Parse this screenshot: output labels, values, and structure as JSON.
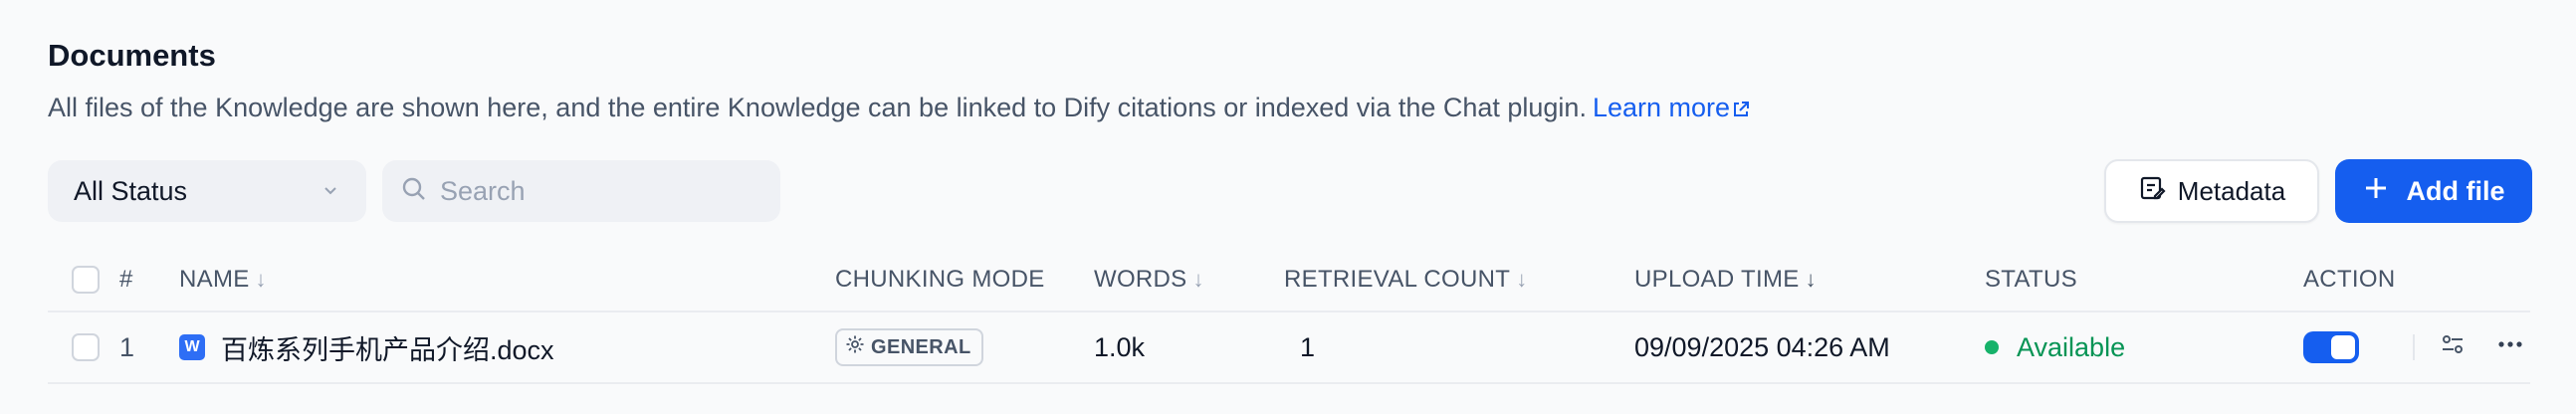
{
  "header": {
    "title": "Documents",
    "description": "All files of the Knowledge are shown here, and the entire Knowledge can be linked to Dify citations or indexed via the Chat plugin.",
    "learn_more": "Learn more"
  },
  "toolbar": {
    "status_filter": "All Status",
    "search_placeholder": "Search",
    "metadata_label": "Metadata",
    "add_file_label": "Add file"
  },
  "table": {
    "columns": {
      "index": "#",
      "name": "NAME",
      "chunking_mode": "CHUNKING MODE",
      "words": "WORDS",
      "retrieval_count": "RETRIEVAL COUNT",
      "upload_time": "UPLOAD TIME",
      "status": "STATUS",
      "action": "ACTION"
    },
    "rows": [
      {
        "index": "1",
        "name": "百炼系列手机产品介绍.docx",
        "file_icon_letter": "W",
        "chunking_mode": "GENERAL",
        "words": "1.0k",
        "retrieval_count": "1",
        "upload_time": "09/09/2025 04:26 AM",
        "status": "Available",
        "enabled": true
      }
    ]
  },
  "colors": {
    "accent": "#155eef",
    "status_available": "#17b26a",
    "text_primary": "#101828",
    "text_secondary": "#475467"
  }
}
